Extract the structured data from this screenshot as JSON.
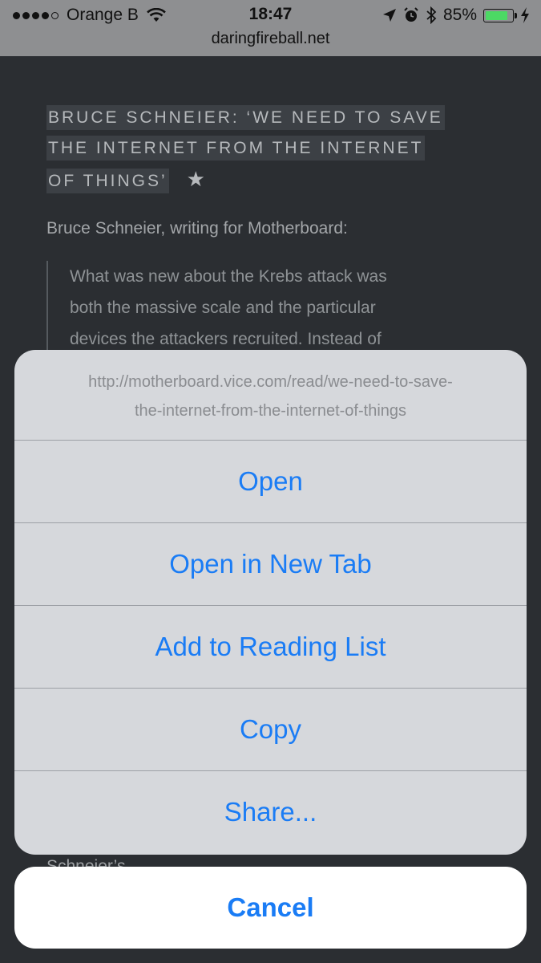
{
  "status_bar": {
    "carrier": "Orange B",
    "time": "18:47",
    "battery": "85%",
    "battery_level": 0.85,
    "url": "daringfireball.net"
  },
  "article": {
    "headline_lines": [
      "BRUCE SCHNEIER: ‘WE NEED TO SAVE",
      "THE INTERNET FROM THE INTERNET",
      "OF THINGS’"
    ],
    "star": "★",
    "byline": "Bruce Schneier, writing for Motherboard:",
    "quote_lines": [
      "What was new about the Krebs attack was",
      "both the massive scale and the particular",
      "devices the attackers recruited. Instead of"
    ],
    "bottom_text": "Schneier’s..."
  },
  "action_sheet": {
    "url_lines": [
      "http://motherboard.vice.com/read/we-need-to-save-",
      "the-internet-from-the-internet-of-things"
    ],
    "open": "Open",
    "open_new_tab": "Open in New Tab",
    "add_reading_list": "Add to Reading List",
    "copy": "Copy",
    "share": "Share...",
    "cancel": "Cancel"
  },
  "colors": {
    "accent": "#1a7cf5",
    "page_bg": "#2b2e32",
    "battery_green": "#4cd964"
  }
}
